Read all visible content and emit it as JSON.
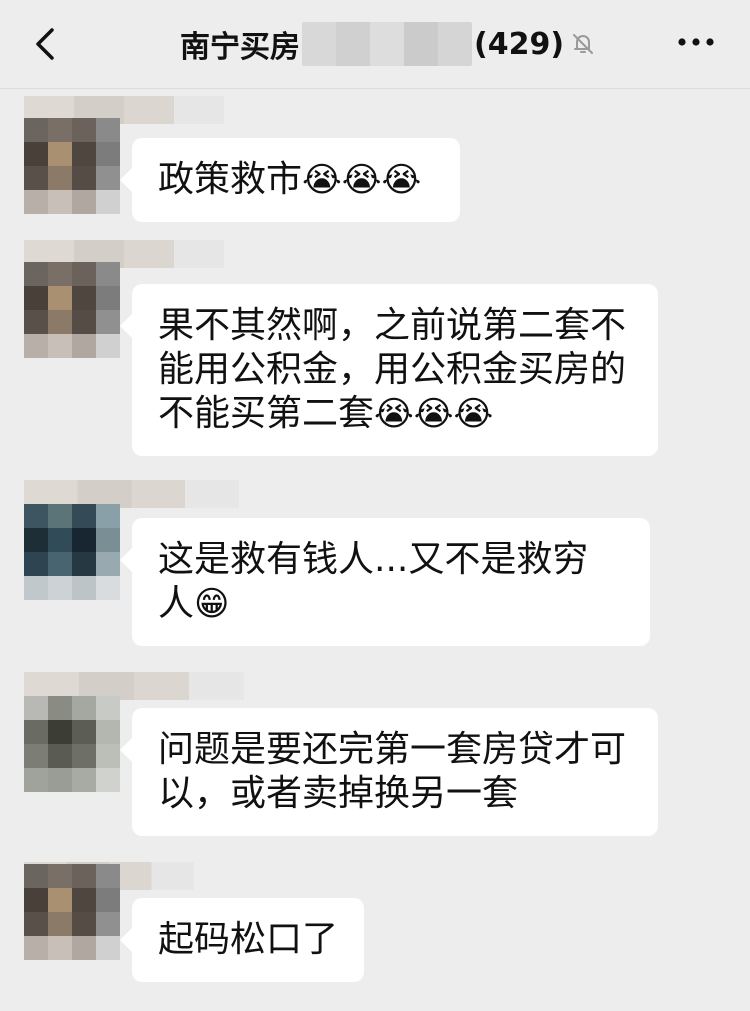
{
  "header": {
    "title_left": "南宁买房",
    "title_count": "(429)",
    "back_icon": "chevron-left-icon",
    "mute_icon": "bell-off-icon",
    "more_icon": "more-dots-icon"
  },
  "messages": [
    {
      "text": "政策救市",
      "emoji": "😭😭😭"
    },
    {
      "text": "果不其然啊，之前说第二套不能用公积金，用公积金买房的不能买第二套",
      "emoji": "😭😭😭"
    },
    {
      "text": "这是救有钱人...又不是救穷人",
      "emoji": "😁"
    },
    {
      "text": "问题是要还完第一套房贷才可以，或者卖掉换另一套",
      "emoji": ""
    },
    {
      "text": "起码松口了",
      "emoji": ""
    }
  ]
}
